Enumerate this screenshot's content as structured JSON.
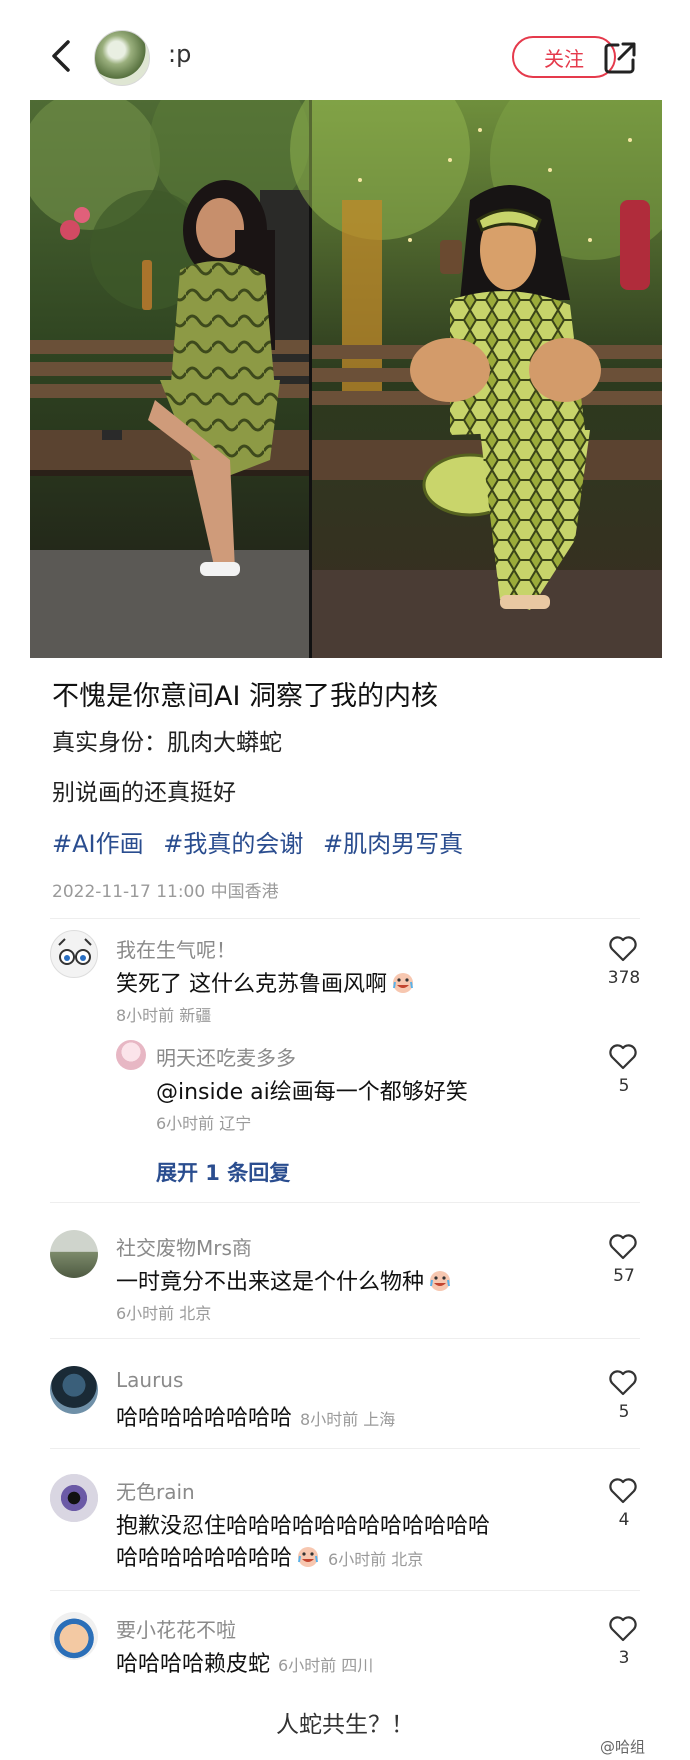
{
  "header": {
    "username": ":p",
    "follow_label": "关注"
  },
  "post": {
    "title": "不愧是你意间AI 洞察了我的内核",
    "line1": "真实身份：肌肉大蟒蛇",
    "line2": "别说画的还真挺好",
    "tags": [
      "#AI作画",
      "#我真的会谢",
      "#肌肉男写真"
    ],
    "meta": "2022-11-17 11:00 中国香港"
  },
  "comments": [
    {
      "name": "我在生气呢！",
      "text": "笑死了 这什么克苏鲁画风啊",
      "meta": "8小时前 新疆",
      "likes": "378"
    },
    {
      "name": "明天还吃麦多多",
      "text": "@inside  ai绘画每一个都够好笑",
      "meta": "6小时前 辽宁",
      "likes": "5",
      "expand": "展开 1 条回复"
    },
    {
      "name": "社交废物Mrs商",
      "text": "一时竟分不出来这是个什么物种",
      "meta": "6小时前 北京",
      "likes": "57"
    },
    {
      "name": "Laurus",
      "text": "哈哈哈哈哈哈哈哈",
      "meta": "8小时前 上海",
      "likes": "5"
    },
    {
      "name": "无色rain",
      "text": "抱歉没忍住哈哈哈哈哈哈哈哈哈哈哈哈",
      "text2": "哈哈哈哈哈哈哈哈",
      "meta": "6小时前 北京",
      "likes": "4"
    },
    {
      "name": "要小花花不啦",
      "text": "哈哈哈哈赖皮蛇",
      "meta": "6小时前 四川",
      "likes": "3"
    }
  ],
  "caption": "人蛇共生？！",
  "watermark": "@哈组",
  "colors": {
    "accent": "#e53a4c",
    "link": "#2a4d8f"
  }
}
